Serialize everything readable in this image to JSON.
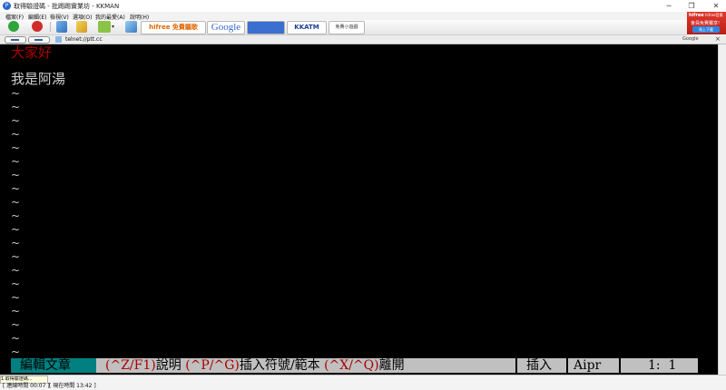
{
  "window": {
    "title": "取得驗證碼 - 批踢踢實業坊 - KKMAN"
  },
  "menu": [
    {
      "label": "檔案(F)"
    },
    {
      "label": "編輯(E)"
    },
    {
      "label": "檢視(V)"
    },
    {
      "label": "選項(O)"
    },
    {
      "label": "我的最愛(A)"
    },
    {
      "label": "說明(H)"
    }
  ],
  "toolbar": {
    "hifree_label": "hifree 免費聽歌",
    "google_label": "Google",
    "kkatm_label": "KKATM",
    "games_label": "免費小遊戲"
  },
  "ad": {
    "brand": "hifree",
    "tagline": "hifree音樂",
    "line": "會員免費獨享!",
    "button": "馬上下載"
  },
  "address": {
    "url": "telnet://ptt.cc",
    "search_label": "Google"
  },
  "terminal": {
    "line1": "大家好",
    "line2": "我是阿湯",
    "tilde": "~",
    "status": {
      "mode": "編輯文章",
      "help_key": "(^Z/F1)",
      "help_label": "說明",
      "insert_key": "(^P/^G)",
      "insert_label": "插入符號/範本",
      "quit_key": "(^X/^Q)",
      "quit_label": "離開",
      "state": "插入",
      "flags": "Aipr",
      "position": "1:  1"
    }
  },
  "taskbar": {
    "tab_label": "1.取得驗證碼..."
  },
  "statusbar": {
    "connect_time": "[ 連線時間 00:07 ]",
    "current_time": "[ 現在時間 13:42 ]"
  },
  "colors": {
    "terminal_bg": "#000000",
    "red_text": "#aa0000",
    "status_mode_bg": "#008080",
    "status_bar_bg": "#c0c0c0"
  }
}
